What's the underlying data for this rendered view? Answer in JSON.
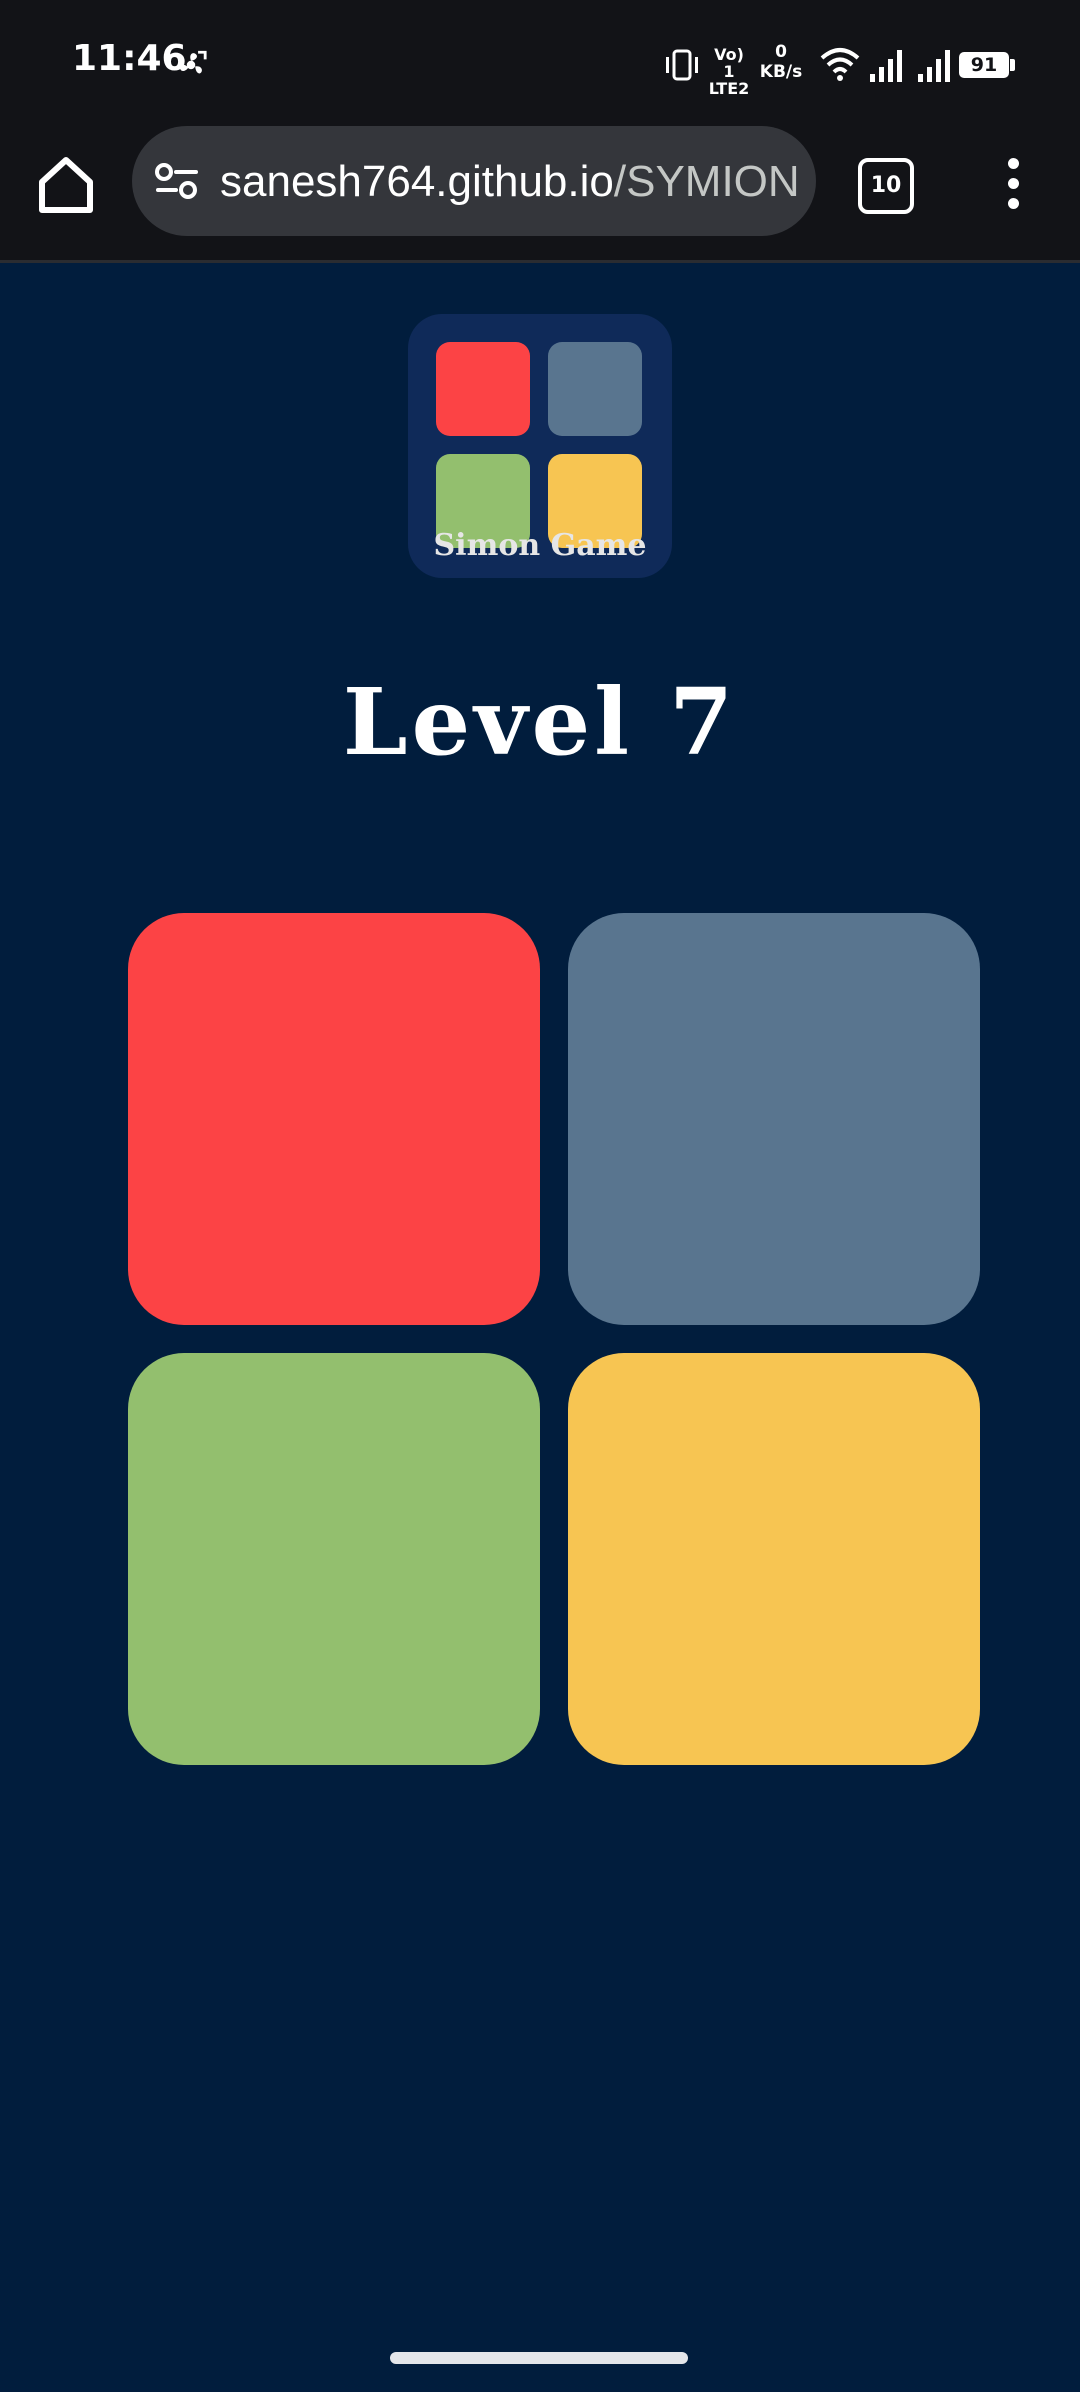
{
  "status_bar": {
    "time": "11:46",
    "network_label_top": "Vo) 1",
    "network_label_bottom": "LTE2",
    "speed_value": "0",
    "speed_unit": "KB/s",
    "battery": "91"
  },
  "browser": {
    "url_host": "sanesh764.github.io",
    "url_path": "/SYMION",
    "tab_count": "10"
  },
  "logo": {
    "caption": "Simon Game",
    "tile_colors": [
      "#fc4345",
      "#59758f",
      "#93bf6e",
      "#f7c552"
    ]
  },
  "game": {
    "level_text": "Level 7",
    "pads": [
      {
        "id": "red",
        "color": "#fc4345"
      },
      {
        "id": "blue",
        "color": "#59758f"
      },
      {
        "id": "green",
        "color": "#93bf6e"
      },
      {
        "id": "yellow",
        "color": "#f7c552"
      }
    ]
  },
  "colors": {
    "background": "#011d3d",
    "chrome": "#121317",
    "logo_bg": "#0f2a59"
  }
}
